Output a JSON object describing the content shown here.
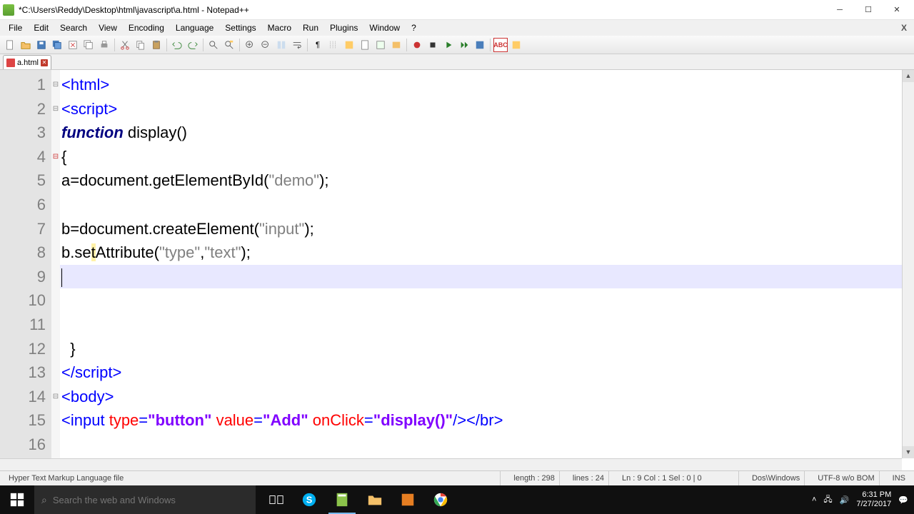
{
  "window": {
    "title": "*C:\\Users\\Reddy\\Desktop\\html\\javascript\\a.html - Notepad++"
  },
  "menu": {
    "items": [
      "File",
      "Edit",
      "Search",
      "View",
      "Encoding",
      "Language",
      "Settings",
      "Macro",
      "Run",
      "Plugins",
      "Window",
      "?"
    ]
  },
  "tab": {
    "label": "a.html"
  },
  "lines": [
    "1",
    "2",
    "3",
    "4",
    "5",
    "6",
    "7",
    "8",
    "9",
    "10",
    "11",
    "12",
    "13",
    "14",
    "15",
    "16"
  ],
  "folds": [
    "⊟",
    "⊟",
    " ",
    "⊟",
    " ",
    " ",
    " ",
    " ",
    " ",
    " ",
    " ",
    " ",
    " ",
    "⊟",
    " ",
    " "
  ],
  "code": {
    "l1": {
      "a": "<",
      "b": "html",
      "c": ">"
    },
    "l2": {
      "a": "<",
      "b": "script",
      "c": ">"
    },
    "l3": {
      "kw": "function",
      "name": " display",
      "p": "()"
    },
    "l4": "{",
    "l5": {
      "a": "a=document.getElementById(",
      "b": "\"demo\"",
      "c": ");"
    },
    "l6": "",
    "l7": {
      "a": "b=document.createElement(",
      "b": "\"input\"",
      "c": ");"
    },
    "l8": {
      "a": "b.se",
      "h": "t",
      "a2": "Attribute(",
      "b": "\"type\"",
      "c": ",",
      "d": "\"text\"",
      "e": ");"
    },
    "l9": "",
    "l10": "",
    "l11": "",
    "l12": "  }",
    "l13": {
      "a": "</",
      "b": "script",
      "c": ">"
    },
    "l14": {
      "a": "<",
      "b": "body",
      "c": ">"
    },
    "l15": {
      "a": "<",
      "b": "input",
      "sp": " ",
      "attr1": "type",
      "eq1": "=",
      "v1": "\"button\"",
      "sp2": " ",
      "attr2": "value",
      "eq2": "=",
      "v2": "\"Add\"",
      "sp3": " ",
      "attr3": "onClick",
      "eq3": "=",
      "v3": "\"display()\"",
      "close": "/></",
      "br": "br",
      "end": ">"
    },
    "l16": ""
  },
  "status": {
    "lang": "Hyper Text Markup Language file",
    "length": "length : 298",
    "lines": "lines : 24",
    "pos": "Ln : 9   Col : 1   Sel : 0 | 0",
    "eol": "Dos\\Windows",
    "enc": "UTF-8 w/o BOM",
    "ins": "INS"
  },
  "taskbar": {
    "search_placeholder": "Search the web and Windows",
    "time": "6:31 PM",
    "date": "7/27/2017"
  }
}
